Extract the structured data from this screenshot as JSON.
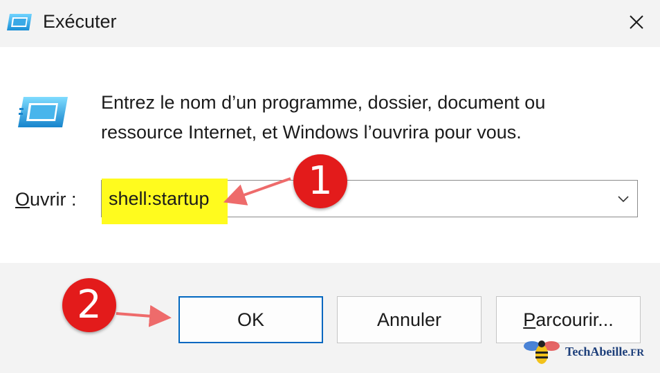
{
  "window": {
    "title": "Exécuter",
    "close_glyph": "✕"
  },
  "description": {
    "line1": "Entrez le nom d’un programme, dossier, document ou",
    "line2": "ressource Internet, et Windows l’ouvrira pour vous."
  },
  "open_field": {
    "label_accel": "O",
    "label_rest": "uvrir :",
    "value": "shell:startup",
    "highlight_color": "#fffb1e"
  },
  "buttons": {
    "ok": {
      "label": "OK"
    },
    "cancel": {
      "label": "Annuler"
    },
    "browse": {
      "label_accel": "P",
      "label_rest": "arcourir..."
    }
  },
  "annotations": {
    "step1": "1",
    "step2": "2",
    "badge_color": "#e31b1b",
    "arrow_color": "#ee6b6b"
  },
  "watermark": {
    "name": "TechAbeille",
    "suffix": ".FR"
  },
  "icons": {
    "title": "run-icon",
    "dialog": "run-icon",
    "combo": "chevron-down-icon",
    "close": "close-icon"
  },
  "colors": {
    "accent": "#0067c0",
    "titlebar_bg": "#f3f3f3",
    "content_bg": "#ffffff"
  }
}
